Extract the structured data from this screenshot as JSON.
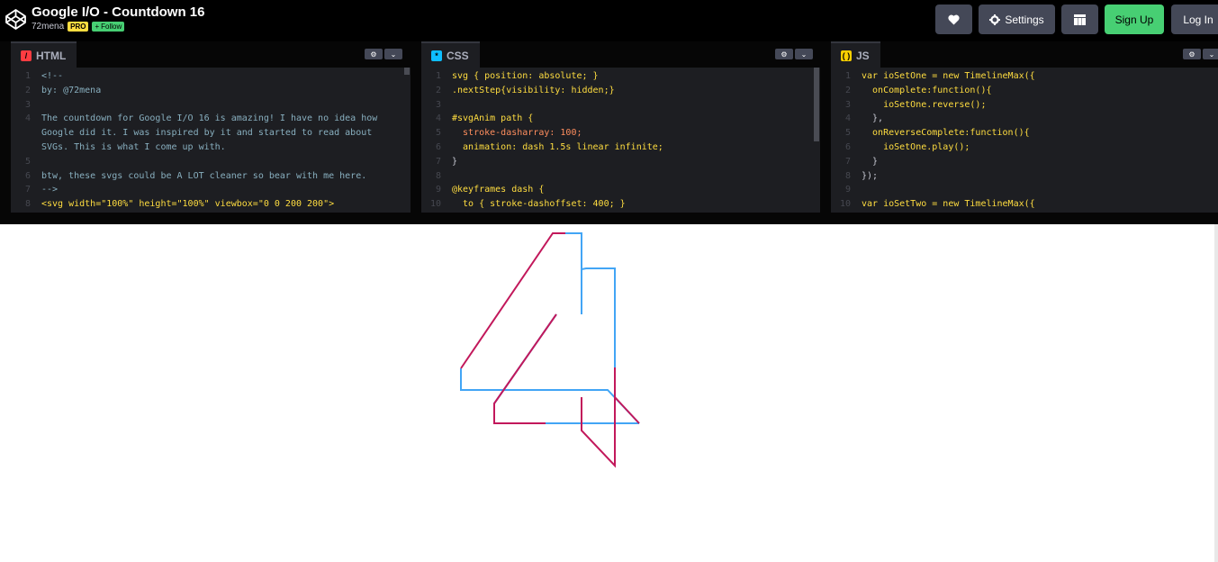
{
  "header": {
    "title": "Google I/O - Countdown 16",
    "author": "72mena",
    "pro_badge": "PRO",
    "follow_label": "Follow",
    "settings_label": "Settings",
    "signup_label": "Sign Up",
    "login_label": "Log In",
    "icons": [
      "codepen-logo-icon",
      "heart-icon",
      "gear-icon",
      "layout-icon",
      "plus-icon"
    ]
  },
  "editors": {
    "html": {
      "tab_label": "HTML",
      "lines": [
        {
          "n": "1",
          "t": "<!--"
        },
        {
          "n": "2",
          "t": "by: @72mena"
        },
        {
          "n": "3",
          "t": ""
        },
        {
          "n": "4",
          "t": "The countdown for Google I/O 16 is amazing! I have no idea how"
        },
        {
          "n": "",
          "t": "Google did it. I was inspired by it and started to read about"
        },
        {
          "n": "",
          "t": "SVGs. This is what I come up with."
        },
        {
          "n": "5",
          "t": ""
        },
        {
          "n": "6",
          "t": "btw, these svgs could be A LOT cleaner so bear with me here."
        },
        {
          "n": "7",
          "t": "-->"
        },
        {
          "n": "8",
          "t": "<svg width=\"100%\" height=\"100%\" viewbox=\"0 0 200 200\">"
        }
      ]
    },
    "css": {
      "tab_label": "CSS",
      "lines": [
        {
          "n": "1",
          "t": "svg { position: absolute; }"
        },
        {
          "n": "2",
          "t": ".nextStep{visibility: hidden;}"
        },
        {
          "n": "3",
          "t": ""
        },
        {
          "n": "4",
          "t": "#svgAnim path {"
        },
        {
          "n": "5",
          "t": "  stroke-dasharray: 100;"
        },
        {
          "n": "6",
          "t": "  animation: dash 1.5s linear infinite;"
        },
        {
          "n": "7",
          "t": "}"
        },
        {
          "n": "8",
          "t": ""
        },
        {
          "n": "9",
          "t": "@keyframes dash {"
        },
        {
          "n": "10",
          "t": "  to { stroke-dashoffset: 400; }"
        }
      ]
    },
    "js": {
      "tab_label": "JS",
      "lines": [
        {
          "n": "1",
          "t": "var ioSetOne = new TimelineMax({"
        },
        {
          "n": "2",
          "t": "  onComplete:function(){"
        },
        {
          "n": "3",
          "t": "    ioSetOne.reverse();"
        },
        {
          "n": "4",
          "t": "  },"
        },
        {
          "n": "5",
          "t": "  onReverseComplete:function(){"
        },
        {
          "n": "6",
          "t": "    ioSetOne.play();"
        },
        {
          "n": "7",
          "t": "  }"
        },
        {
          "n": "8",
          "t": "});"
        },
        {
          "n": "9",
          "t": ""
        },
        {
          "n": "10",
          "t": "var ioSetTwo = new TimelineMax({"
        }
      ]
    }
  },
  "preview": {
    "figure": "4",
    "colors": {
      "magenta": "#c2185b",
      "blue": "#42a5f5"
    }
  }
}
